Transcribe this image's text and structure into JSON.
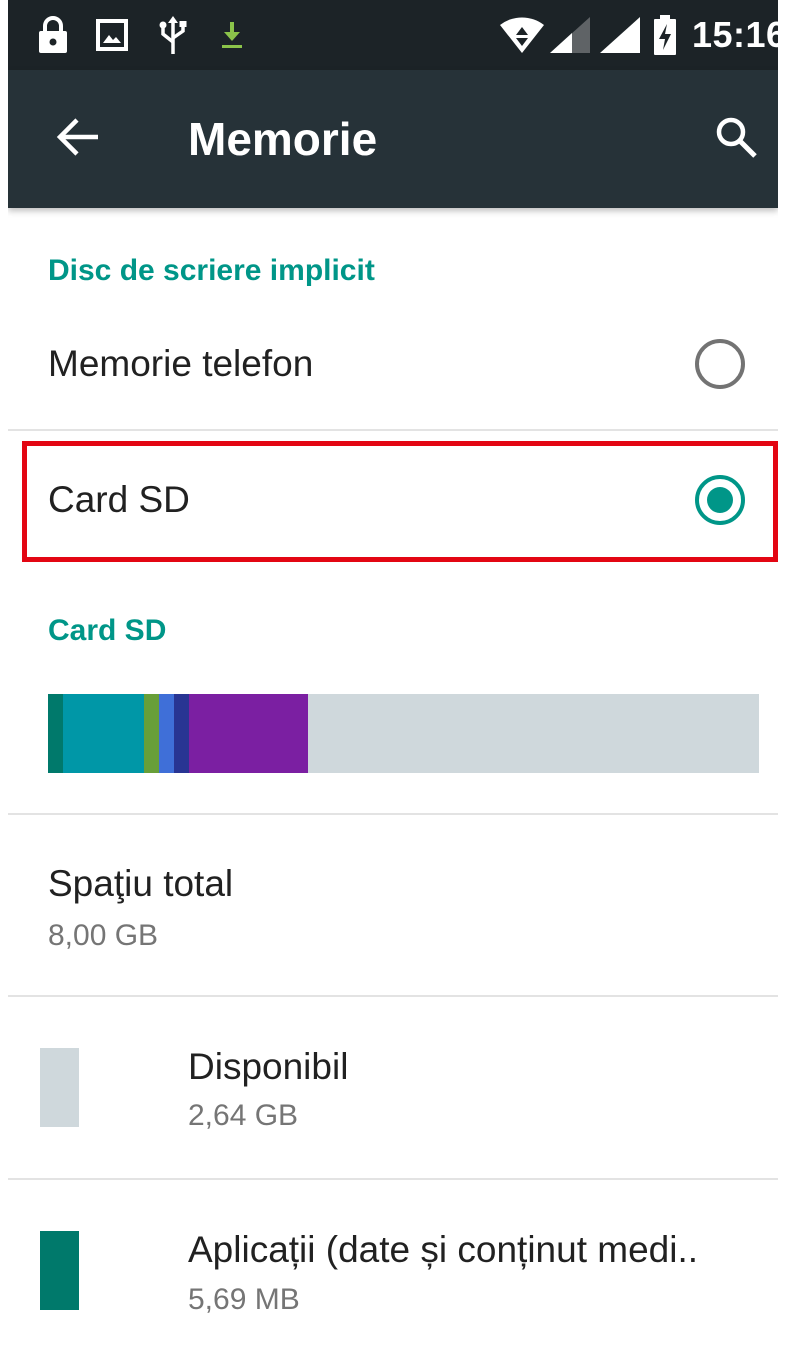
{
  "status_bar": {
    "time": "15:16",
    "icons": [
      "lock-icon",
      "image-icon",
      "usb-icon",
      "download-icon",
      "wifi-icon",
      "signal-icon",
      "signal-icon",
      "battery-charging-icon"
    ]
  },
  "app_bar": {
    "title": "Memorie",
    "back_icon": "arrow-left-icon",
    "search_icon": "search-icon"
  },
  "default_disk": {
    "header": "Disc de scriere implicit",
    "options": [
      {
        "label": "Memorie telefon",
        "selected": false
      },
      {
        "label": "Card SD",
        "selected": true
      }
    ]
  },
  "sd_card": {
    "header": "Card SD",
    "usage_bar": {
      "free_color": "#cfd8dc",
      "segments": [
        {
          "color": "#00796b",
          "fraction": 0.021
        },
        {
          "color": "#0097a7",
          "fraction": 0.114
        },
        {
          "color": "#689f38",
          "fraction": 0.021
        },
        {
          "color": "#3f6fd8",
          "fraction": 0.021
        },
        {
          "color": "#283593",
          "fraction": 0.021
        },
        {
          "color": "#7b1fa2",
          "fraction": 0.167
        }
      ]
    },
    "total": {
      "label": "Spaţiu total",
      "value": "8,00 GB"
    },
    "items": [
      {
        "label": "Disponibil",
        "value": "2,64 GB",
        "color": "#cfd8dc"
      },
      {
        "label": "Aplicații (date și conținut medi..",
        "value": "5,69 MB",
        "color": "#00796b"
      }
    ]
  },
  "accent_color": "#009688",
  "highlight_color": "#e30613"
}
